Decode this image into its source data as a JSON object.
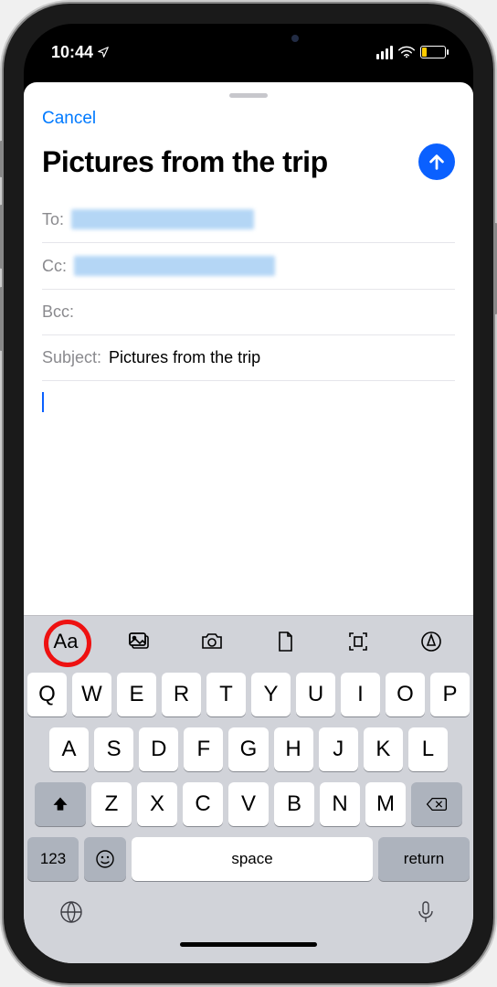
{
  "status": {
    "time": "10:44"
  },
  "sheet": {
    "cancel": "Cancel",
    "title": "Pictures from the trip",
    "to_label": "To:",
    "cc_label": "Cc:",
    "bcc_label": "Bcc:",
    "subject_label": "Subject:",
    "subject_value": "Pictures from the trip"
  },
  "format_bar": {
    "text_format": "Aa"
  },
  "keyboard": {
    "row1": [
      "Q",
      "W",
      "E",
      "R",
      "T",
      "Y",
      "U",
      "I",
      "O",
      "P"
    ],
    "row2": [
      "A",
      "S",
      "D",
      "F",
      "G",
      "H",
      "J",
      "K",
      "L"
    ],
    "row3": [
      "Z",
      "X",
      "C",
      "V",
      "B",
      "N",
      "M"
    ],
    "numbers": "123",
    "space": "space",
    "return": "return"
  }
}
